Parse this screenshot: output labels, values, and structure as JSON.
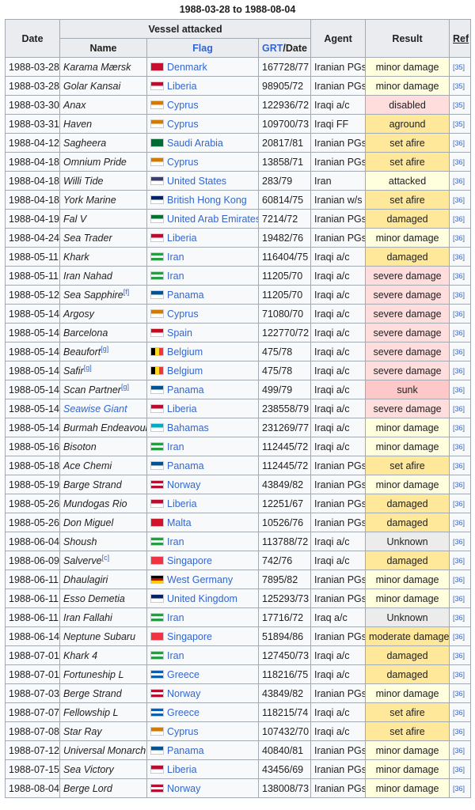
{
  "caption": "1988-03-28 to 1988-08-04",
  "headers": {
    "date": "Date",
    "vessel_attacked": "Vessel attacked",
    "name": "Name",
    "flag": "Flag",
    "grt": "GRT",
    "grt_suffix": "/Date",
    "agent": "Agent",
    "result": "Result",
    "ref": "Ref"
  },
  "flags": {
    "Denmark": "#c8102e",
    "Liberia": "#bf0a30",
    "Cyprus": "#d57800",
    "Saudi Arabia": "#006c35",
    "United States": "#3c3b6e",
    "British Hong Kong": "#012169",
    "United Arab Emirates": "#00732f",
    "Iran": "#239f40",
    "Panama": "#005293",
    "Spain": "#c60b1e",
    "Belgium": "#fdda24",
    "Bahamas": "#00abc9",
    "Norway": "#ba0c2f",
    "Malta": "#cf142b",
    "Singapore": "#ef3340",
    "West Germany": "#dd0000",
    "United Kingdom": "#012169",
    "Greece": "#0d5eaf"
  },
  "rows": [
    {
      "date": "1988-03-28",
      "name": "Karama Mærsk",
      "note": "",
      "name_link": false,
      "flag": "Denmark",
      "grt": "167728/77",
      "agent": "Iranian PGs",
      "result": "minor damage",
      "rclass": "res-minor",
      "ref": "[35]"
    },
    {
      "date": "1988-03-28",
      "name": "Golar Kansai",
      "note": "",
      "name_link": false,
      "flag": "Liberia",
      "grt": "98905/72",
      "agent": "Iranian PGs",
      "result": "minor damage",
      "rclass": "res-minor",
      "ref": "[35]"
    },
    {
      "date": "1988-03-30",
      "name": "Anax",
      "note": "",
      "name_link": false,
      "flag": "Cyprus",
      "grt": "122936/72",
      "agent": "Iraqi a/c",
      "result": "disabled",
      "rclass": "res-disabled",
      "ref": "[35]"
    },
    {
      "date": "1988-03-31",
      "name": "Haven",
      "note": "",
      "name_link": false,
      "flag": "Cyprus",
      "grt": "109700/73",
      "agent": "Iraqi FF",
      "result": "aground",
      "rclass": "res-aground",
      "ref": "[35]"
    },
    {
      "date": "1988-04-12",
      "name": "Sagheera",
      "note": "",
      "name_link": false,
      "flag": "Saudi Arabia",
      "grt": "20817/81",
      "agent": "Iranian PGs",
      "result": "set afire",
      "rclass": "res-fire",
      "ref": "[36]"
    },
    {
      "date": "1988-04-18",
      "name": "Omnium Pride",
      "note": "",
      "name_link": false,
      "flag": "Cyprus",
      "grt": "13858/71",
      "agent": "Iranian PGs",
      "result": "set afire",
      "rclass": "res-fire",
      "ref": "[36]"
    },
    {
      "date": "1988-04-18",
      "name": "Willi Tide",
      "note": "",
      "name_link": false,
      "flag": "United States",
      "grt": "283/79",
      "agent": "Iran",
      "result": "attacked",
      "rclass": "res-attacked",
      "ref": "[36]"
    },
    {
      "date": "1988-04-18",
      "name": "York Marine",
      "note": "",
      "name_link": false,
      "flag": "British Hong Kong",
      "grt": "60814/75",
      "agent": "Iranian w/s",
      "result": "set afire",
      "rclass": "res-fire",
      "ref": "[36]"
    },
    {
      "date": "1988-04-19",
      "name": "Fal V",
      "note": "",
      "name_link": false,
      "flag": "United Arab Emirates",
      "grt": "7214/72",
      "agent": "Iranian PGs",
      "result": "damaged",
      "rclass": "res-damaged",
      "ref": "[36]"
    },
    {
      "date": "1988-04-24",
      "name": "Sea Trader",
      "note": "",
      "name_link": false,
      "flag": "Liberia",
      "grt": "19482/76",
      "agent": "Iranian PGs",
      "result": "minor damage",
      "rclass": "res-minor",
      "ref": "[36]"
    },
    {
      "date": "1988-05-11",
      "name": "Khark",
      "note": "",
      "name_link": false,
      "flag": "Iran",
      "grt": "116404/75",
      "agent": "Iraqi a/c",
      "result": "damaged",
      "rclass": "res-damaged",
      "ref": "[36]"
    },
    {
      "date": "1988-05-11",
      "name": "Iran Nahad",
      "note": "",
      "name_link": false,
      "flag": "Iran",
      "grt": "11205/70",
      "agent": "Iraqi a/c",
      "result": "severe damage",
      "rclass": "res-severe",
      "ref": "[36]"
    },
    {
      "date": "1988-05-12",
      "name": "Sea Sapphire",
      "note": "[f]",
      "name_link": false,
      "flag": "Panama",
      "grt": "11205/70",
      "agent": "Iraqi a/c",
      "result": "severe damage",
      "rclass": "res-severe",
      "ref": "[36]"
    },
    {
      "date": "1988-05-14",
      "name": "Argosy",
      "note": "",
      "name_link": false,
      "flag": "Cyprus",
      "grt": "71080/70",
      "agent": "Iraqi a/c",
      "result": "severe damage",
      "rclass": "res-severe",
      "ref": "[36]"
    },
    {
      "date": "1988-05-14",
      "name": "Barcelona",
      "note": "",
      "name_link": false,
      "flag": "Spain",
      "grt": "122770/72",
      "agent": "Iraqi a/c",
      "result": "severe damage",
      "rclass": "res-severe",
      "ref": "[36]"
    },
    {
      "date": "1988-05-14",
      "name": "Beaufort",
      "note": "[g]",
      "name_link": false,
      "flag": "Belgium",
      "grt": "475/78",
      "agent": "Iraqi a/c",
      "result": "severe damage",
      "rclass": "res-severe",
      "ref": "[36]"
    },
    {
      "date": "1988-05-14",
      "name": "Safir",
      "note": "[g]",
      "name_link": false,
      "flag": "Belgium",
      "grt": "475/78",
      "agent": "Iraqi a/c",
      "result": "severe damage",
      "rclass": "res-severe",
      "ref": "[36]"
    },
    {
      "date": "1988-05-14",
      "name": "Scan Partner",
      "note": "[g]",
      "name_link": false,
      "flag": "Panama",
      "grt": "499/79",
      "agent": "Iraqi a/c",
      "result": "sunk",
      "rclass": "res-sunk",
      "ref": "[36]"
    },
    {
      "date": "1988-05-14",
      "name": "Seawise Giant",
      "note": "",
      "name_link": true,
      "flag": "Liberia",
      "grt": "238558/79",
      "agent": "Iraqi a/c",
      "result": "severe damage",
      "rclass": "res-severe",
      "ref": "[36]"
    },
    {
      "date": "1988-05-14",
      "name": "Burmah Endeavour",
      "note": "",
      "name_link": false,
      "flag": "Bahamas",
      "grt": "231269/77",
      "agent": "Iraqi a/c",
      "result": "minor damage",
      "rclass": "res-minor",
      "ref": "[36]"
    },
    {
      "date": "1988-05-16",
      "name": "Bisoton",
      "note": "",
      "name_link": false,
      "flag": "Iran",
      "grt": "112445/72",
      "agent": "Iraqi a/c",
      "result": "minor damage",
      "rclass": "res-minor",
      "ref": "[36]"
    },
    {
      "date": "1988-05-18",
      "name": "Ace Chemi",
      "note": "",
      "name_link": false,
      "flag": "Panama",
      "grt": "112445/72",
      "agent": "Iranian PGs",
      "result": "set afire",
      "rclass": "res-fire",
      "ref": "[36]"
    },
    {
      "date": "1988-05-19",
      "name": "Barge Strand",
      "note": "",
      "name_link": false,
      "flag": "Norway",
      "grt": "43849/82",
      "agent": "Iranian PGs",
      "result": "minor damage",
      "rclass": "res-minor",
      "ref": "[36]"
    },
    {
      "date": "1988-05-26",
      "name": "Mundogas Rio",
      "note": "",
      "name_link": false,
      "flag": "Liberia",
      "grt": "12251/67",
      "agent": "Iranian PGs",
      "result": "damaged",
      "rclass": "res-damaged",
      "ref": "[36]"
    },
    {
      "date": "1988-05-26",
      "name": "Don Miguel",
      "note": "",
      "name_link": false,
      "flag": "Malta",
      "grt": "10526/76",
      "agent": "Iranian PGs",
      "result": "damaged",
      "rclass": "res-damaged",
      "ref": "[36]"
    },
    {
      "date": "1988-06-04",
      "name": "Shoush",
      "note": "",
      "name_link": false,
      "flag": "Iran",
      "grt": "113788/72",
      "agent": "Iraqi a/c",
      "result": "Unknown",
      "rclass": "res-unknown",
      "ref": "[36]"
    },
    {
      "date": "1988-06-09",
      "name": "Salverve",
      "note": "[c]",
      "name_link": false,
      "flag": "Singapore",
      "grt": "742/76",
      "agent": "Iraqi a/c",
      "result": "damaged",
      "rclass": "res-damaged",
      "ref": "[36]"
    },
    {
      "date": "1988-06-11",
      "name": "Dhaulagiri",
      "note": "",
      "name_link": false,
      "flag": "West Germany",
      "grt": "7895/82",
      "agent": "Iranian PGs",
      "result": "minor damage",
      "rclass": "res-minor",
      "ref": "[36]"
    },
    {
      "date": "1988-06-11",
      "name": "Esso Demetia",
      "note": "",
      "name_link": false,
      "flag": "United Kingdom",
      "grt": "125293/73",
      "agent": "Iranian PGs",
      "result": "minor damage",
      "rclass": "res-minor",
      "ref": "[36]"
    },
    {
      "date": "1988-06-11",
      "name": "Iran Fallahi",
      "note": "",
      "name_link": false,
      "flag": "Iran",
      "grt": "17716/72",
      "agent": "Iraq a/c",
      "result": "Unknown",
      "rclass": "res-unknown",
      "ref": "[36]"
    },
    {
      "date": "1988-06-14",
      "name": "Neptune Subaru",
      "note": "",
      "name_link": false,
      "flag": "Singapore",
      "grt": "51894/86",
      "agent": "Iranian PGs",
      "result": "moderate damage",
      "rclass": "res-moderate",
      "ref": "[36]"
    },
    {
      "date": "1988-07-01",
      "name": "Khark 4",
      "note": "",
      "name_link": false,
      "flag": "Iran",
      "grt": "127450/73",
      "agent": "Iraqi a/c",
      "result": "damaged",
      "rclass": "res-damaged",
      "ref": "[36]"
    },
    {
      "date": "1988-07-01",
      "name": "Fortuneship L",
      "note": "",
      "name_link": false,
      "flag": "Greece",
      "grt": "118216/75",
      "agent": "Iraqi a/c",
      "result": "damaged",
      "rclass": "res-damaged",
      "ref": "[36]"
    },
    {
      "date": "1988-07-03",
      "name": "Berge Strand",
      "note": "",
      "name_link": false,
      "flag": "Norway",
      "grt": "43849/82",
      "agent": "Iranian PGs",
      "result": "minor damage",
      "rclass": "res-minor",
      "ref": "[36]"
    },
    {
      "date": "1988-07-07",
      "name": "Fellowship L",
      "note": "",
      "name_link": false,
      "flag": "Greece",
      "grt": "118215/74",
      "agent": "Iraqi a/c",
      "result": "set afire",
      "rclass": "res-fire",
      "ref": "[36]"
    },
    {
      "date": "1988-07-08",
      "name": "Star Ray",
      "note": "",
      "name_link": false,
      "flag": "Cyprus",
      "grt": "107432/70",
      "agent": "Iraqi a/c",
      "result": "set afire",
      "rclass": "res-fire",
      "ref": "[36]"
    },
    {
      "date": "1988-07-12",
      "name": "Universal Monarch",
      "note": "",
      "name_link": false,
      "flag": "Panama",
      "grt": "40840/81",
      "agent": "Iranian PGs",
      "result": "minor damage",
      "rclass": "res-minor",
      "ref": "[36]"
    },
    {
      "date": "1988-07-15",
      "name": "Sea Victory",
      "note": "",
      "name_link": false,
      "flag": "Liberia",
      "grt": "43456/69",
      "agent": "Iranian PGs",
      "result": "minor damage",
      "rclass": "res-minor",
      "ref": "[36]"
    },
    {
      "date": "1988-08-04",
      "name": "Berge Lord",
      "note": "",
      "name_link": false,
      "flag": "Norway",
      "grt": "138008/73",
      "agent": "Iranian PGs",
      "result": "minor damage",
      "rclass": "res-minor",
      "ref": "[36]"
    }
  ]
}
